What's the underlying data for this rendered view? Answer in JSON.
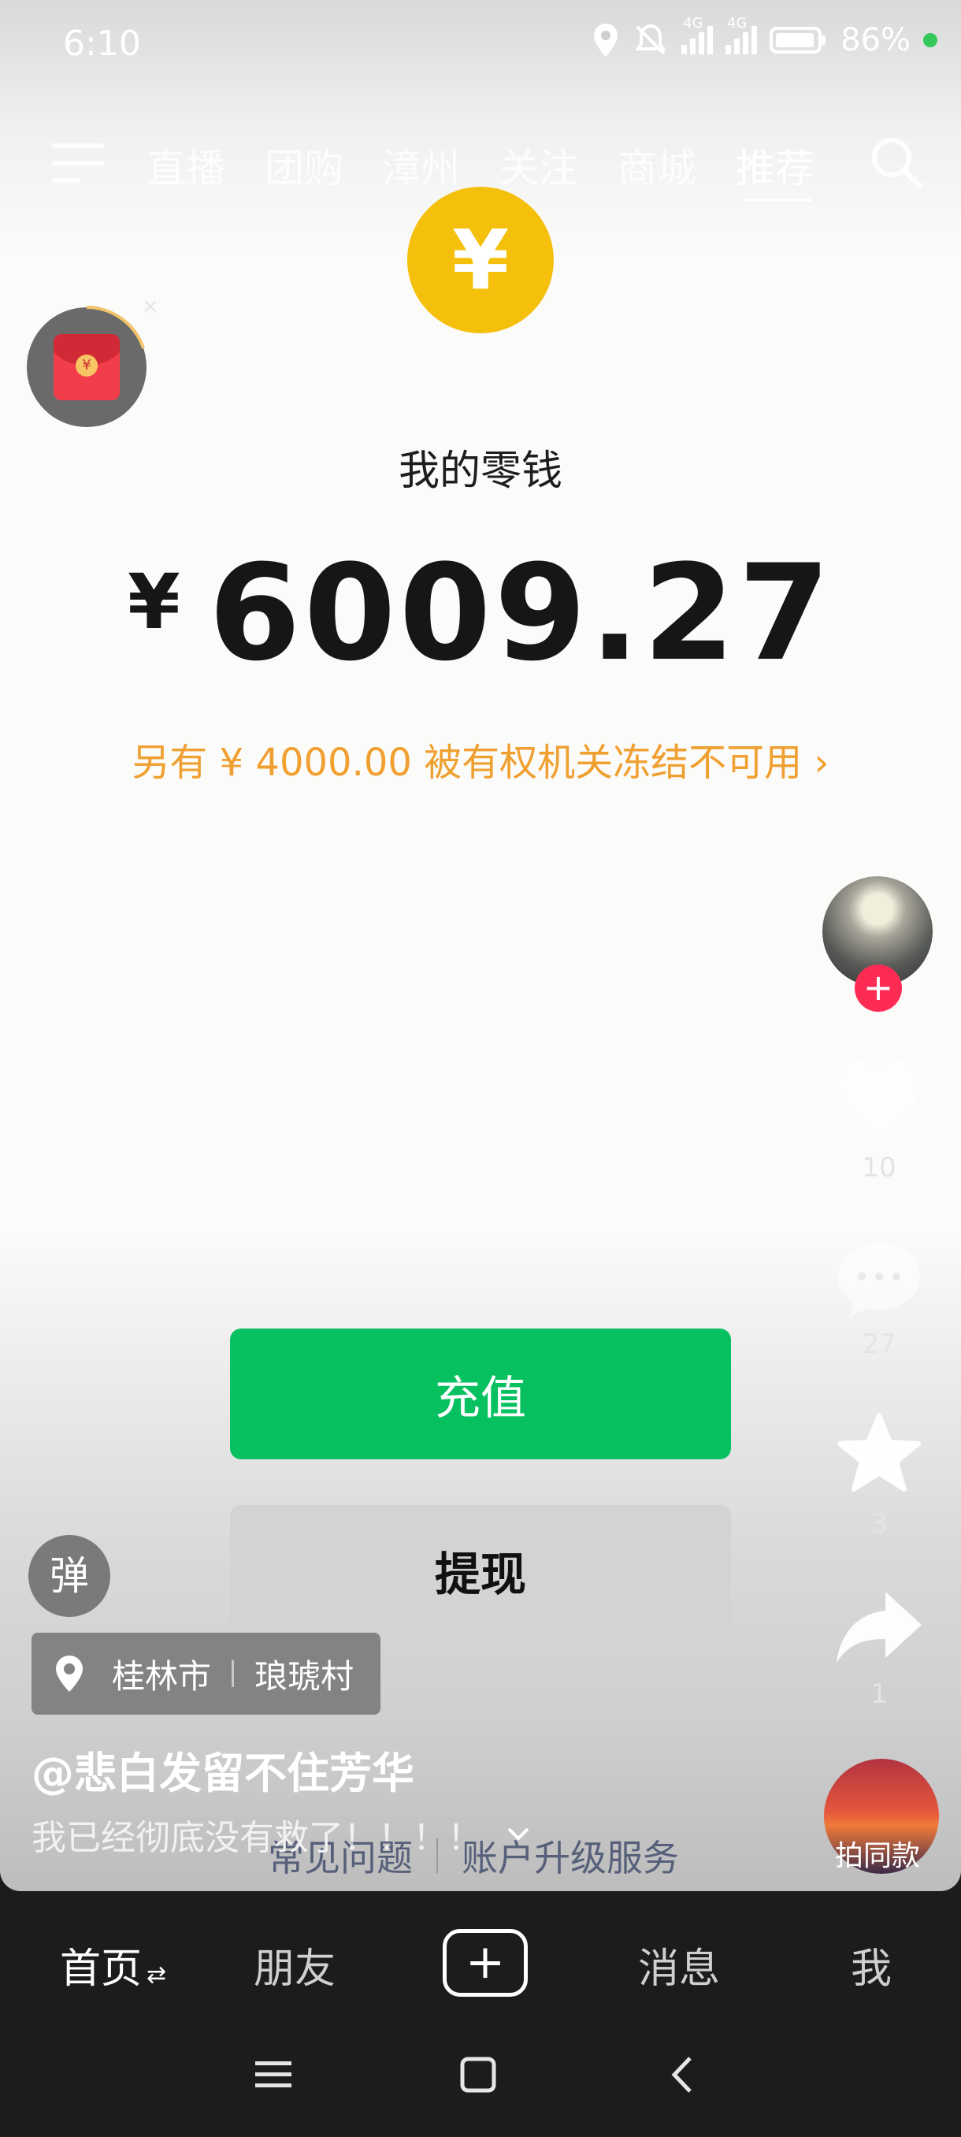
{
  "status_bar": {
    "time": "6:10",
    "battery_percent": "86%",
    "network_1": "4G",
    "network_2": "4G"
  },
  "top_nav": {
    "tabs": [
      "直播",
      "团购",
      "漳州",
      "关注",
      "商城",
      "推荐"
    ],
    "active_tab": "推荐"
  },
  "wallet": {
    "icon_glyph": "¥",
    "title": "我的零钱",
    "currency_symbol": "¥",
    "balance": "6009.27",
    "frozen_notice": "另有 ¥ 4000.00 被有权机关冻结不可用 ›",
    "recharge_label": "充值",
    "withdraw_label": "提现",
    "faq_link": "常见问题",
    "upgrade_link": "账户升级服务"
  },
  "sidebar": {
    "likes": "10",
    "comments": "27",
    "favorites": "3",
    "shares": "1",
    "sound_label": "拍同款"
  },
  "video_info": {
    "danmu_label": "弹",
    "location_city": "桂林市",
    "location_place": "琅琥村",
    "author": "@悲白发留不住芳华",
    "description": "我已经彻底没有救了！！！！"
  },
  "bottom_nav": {
    "home": "首页",
    "friends": "朋友",
    "messages": "消息",
    "me": "我"
  },
  "colors": {
    "accent_green": "#07c160",
    "yen_gold": "#f5c00b",
    "warning_orange": "#f0a030",
    "follow_red": "#fe2c55"
  }
}
